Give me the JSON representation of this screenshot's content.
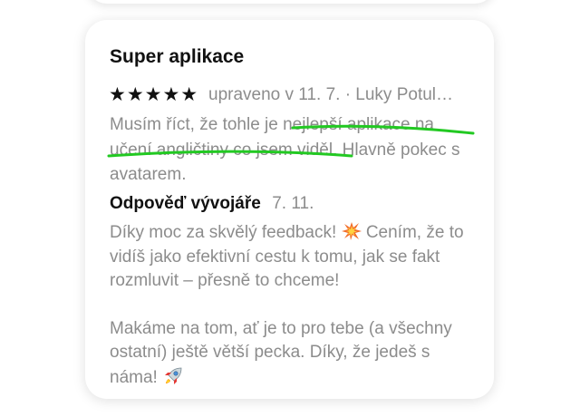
{
  "review": {
    "title": "Super aplikace",
    "rating": 5,
    "stars_text": "★★★★★",
    "meta": "upraveno v 11. 7. · Luky Potul…",
    "body": "Musím říct, že tohle je nejlepší aplikace na učení angličtiny co jsem viděl. Hlavně pokec s avatarem."
  },
  "developer_response": {
    "heading": "Odpověď vývojáře",
    "date": "7. 11.",
    "paragraph1_text": "Díky moc za skvělý feedback!",
    "paragraph1_emoji": "sparkle-icon",
    "paragraph1_rest": " Cením, že to vidíš jako efektivní cestu k tomu, jak se fakt rozmluvit – přesně to chceme!",
    "paragraph2_text": "Makáme na tom, ať je to pro tebe (a všechny ostatní) ještě větší pecka. Díky, že jedeš s náma! ",
    "paragraph2_emoji": "rocket-icon"
  },
  "colors": {
    "text_primary": "#111111",
    "text_secondary": "#8c8c8c",
    "annotation": "#22c922",
    "card_background": "#ffffff"
  }
}
